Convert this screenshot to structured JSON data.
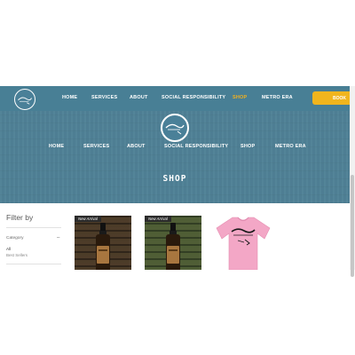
{
  "topbar": {
    "nav": [
      "HOME",
      "SERVICES",
      "ABOUT",
      "SOCIAL RESPONSIBILITY",
      "SHOP",
      "METRO ERA"
    ],
    "active": "SHOP",
    "book_label": "BOOK",
    "accent": "#f0b51e",
    "bg": "#487f95"
  },
  "hero": {
    "nav": [
      "HOME",
      "SERVICES",
      "ABOUT",
      "SOCIAL RESPONSIBILITY",
      "SHOP",
      "METRO ERA"
    ],
    "title": "SHOP",
    "bg": "#4f8196"
  },
  "logo": {
    "icon": "barber-shop-logo-icon"
  },
  "filter": {
    "title": "Filter by",
    "category_label": "Category",
    "collapse_symbol": "–",
    "options": [
      "All",
      "Best Sellers"
    ],
    "selected": "All"
  },
  "products": [
    {
      "badge": "New Arrival",
      "image": "beard-oil-bottle-icon"
    },
    {
      "badge": "New Arrival",
      "image": "beard-oil-bottle-icon"
    },
    {
      "badge": "",
      "image": "pink-tshirt-icon"
    }
  ]
}
